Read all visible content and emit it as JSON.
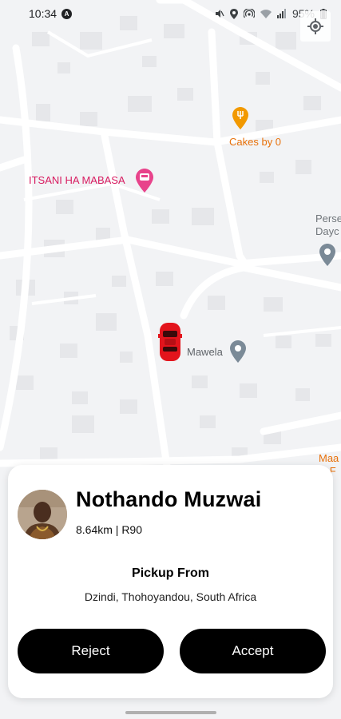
{
  "status_bar": {
    "time": "10:34",
    "battery": "95%"
  },
  "map": {
    "poi_cakes": "Cakes by 0",
    "poi_itsani": "ITSANI HA MABASA",
    "poi_mawela": "Mawela",
    "poi_perse_line1": "Perse",
    "poi_perse_line2": "Dayc",
    "poi_maa_line1": "Maa",
    "poi_maa_line2": "st F"
  },
  "request": {
    "driver_name": "Nothando Muzwai",
    "trip_meta": "8.64km | R90",
    "pickup_label": "Pickup From",
    "pickup_address": "Dzindi, Thohoyandou, South Africa",
    "reject_label": "Reject",
    "accept_label": "Accept"
  },
  "colors": {
    "accent": "#000000",
    "car": "#e3141c",
    "poi_food": "#e8710a",
    "poi_pink": "#d81b60"
  },
  "icons": [
    "navigation-a-icon",
    "mute-icon",
    "location-icon",
    "hotspot-icon",
    "wifi-icon",
    "signal-icon",
    "battery-icon",
    "my-location-icon",
    "restaurant-pin-icon",
    "bus-pin-icon",
    "place-pin-icon",
    "car-marker-icon"
  ]
}
